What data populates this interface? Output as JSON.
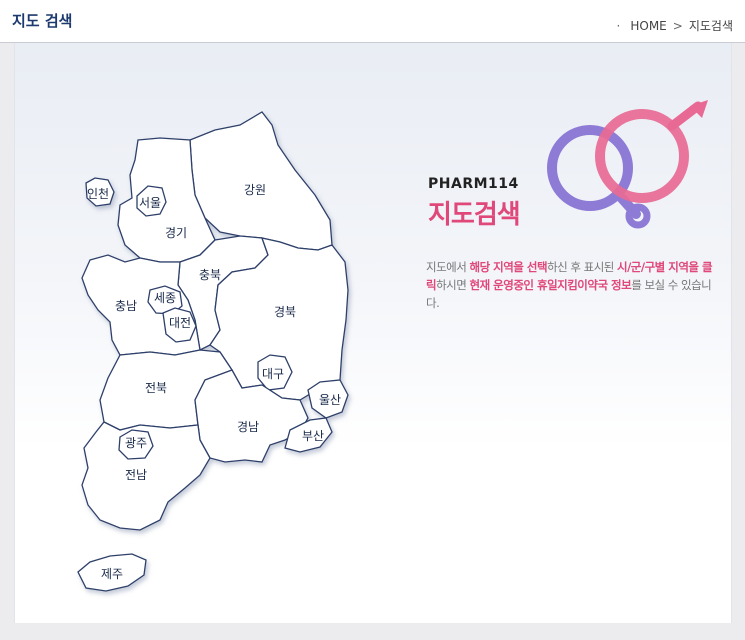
{
  "header": {
    "title": "지도 검색",
    "breadcrumb": {
      "home": "HOME",
      "separator": ">",
      "current": "지도검색"
    }
  },
  "intro": {
    "brand": "PHARM114",
    "heading": "지도검색",
    "description": [
      {
        "text": "지도에서 ",
        "highlight": false
      },
      {
        "text": "해당 지역을 선택",
        "highlight": true
      },
      {
        "text": "하신 후 표시된 ",
        "highlight": false
      },
      {
        "text": "시/군/구별 지역을 클릭",
        "highlight": true
      },
      {
        "text": "하시면  ",
        "highlight": false
      },
      {
        "text": "현재 운영중인 휴일지킴이약국 정보",
        "highlight": true
      },
      {
        "text": "를 보실 수 있습니다.",
        "highlight": false
      }
    ]
  },
  "map": {
    "regions": {
      "incheon": "인천",
      "seoul": "서울",
      "gyeonggi": "경기",
      "gangwon": "강원",
      "chungbuk": "충북",
      "chungnam": "충남",
      "sejong": "세종",
      "daejeon": "대전",
      "gyeongbuk": "경북",
      "daegu": "대구",
      "jeonbuk": "전북",
      "ulsan": "울산",
      "gyeongnam": "경남",
      "busan": "부산",
      "gwangju": "광주",
      "jeonnam": "전남",
      "jeju": "제주"
    }
  },
  "colors": {
    "accent_pink": "#e0487a",
    "accent_purple": "#8e7bd6",
    "title_navy": "#1d3a6e",
    "map_stroke": "#2d3f6a"
  }
}
